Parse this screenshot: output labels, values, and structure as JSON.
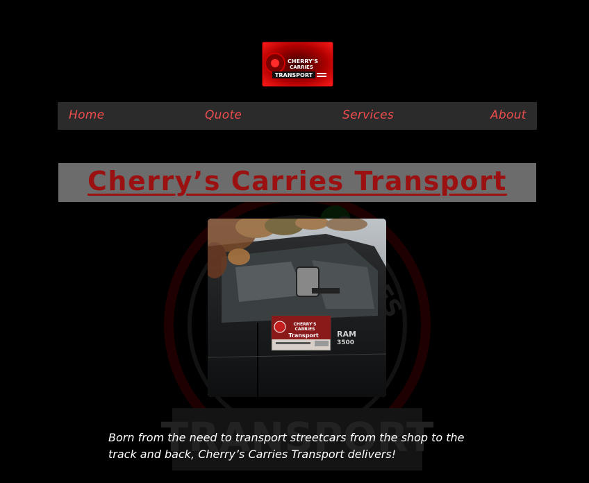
{
  "header": {
    "logo": {
      "line1": "CHERRY'S",
      "line2": "CARRIES",
      "line3": "TRANSPORT"
    }
  },
  "nav": {
    "items": [
      {
        "label": "Home"
      },
      {
        "label": "Quote"
      },
      {
        "label": "Services"
      },
      {
        "label": "About"
      }
    ]
  },
  "hero": {
    "title": "Cherry’s Carries Transport"
  },
  "photo": {
    "door_sign": {
      "line1": "CHERRY'S",
      "line2": "CARRIES",
      "line3": "Transport"
    },
    "badge_line1": "RAM",
    "badge_line2": "3500"
  },
  "intro": {
    "text": "Born from the need to transport streetcars from the shop to the track and back, Cherry’s Carries Transport delivers!"
  },
  "watermark": {
    "text": "CHERRY'S CARRIES TRANSPORT"
  },
  "colors": {
    "background": "#000000",
    "nav_bg": "#2b2b2b",
    "nav_text": "#ef4d4d",
    "title_bg": "#6c6c6c",
    "title_text": "#9b1111"
  }
}
